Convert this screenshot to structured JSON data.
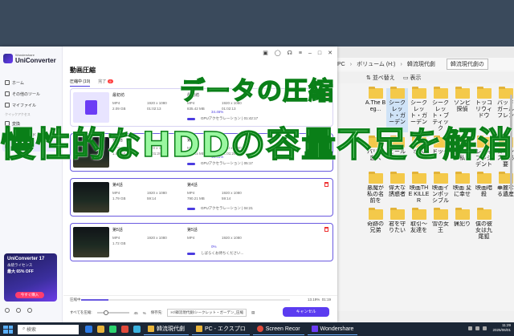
{
  "explorer": {
    "breadcrumb": [
      "PC",
      "ボリューム (H:)",
      "韓流現代劇"
    ],
    "current_folder": "韓流現代劇の",
    "commands": {
      "sort": "並べ替え",
      "view": "表示"
    },
    "folders": [
      "A.The Beg...",
      "シークレット・ガーデン",
      "シークレット・ガーデン",
      "シークレット・ブティック",
      "ゾンビ探偵",
      "トッコ リウィドウ",
      "バッド ガールフレン",
      "パリの恋人",
      "ビール",
      "ボス",
      "ドッグ",
      "ダンスは私と",
      "レディプレジデント",
      "ロマンスが必要",
      "悪魔が私の名前を",
      "偉大な誘惑者",
      "映画THE KILLER",
      "映画インポッシブル",
      "映画 変に幸せ",
      "映画暗殺",
      "華麗なる遺産",
      "奇跡の兄弟",
      "君を守りたい",
      "取引～友達を",
      "雪の女王",
      "猟犯り",
      "僕の彼女は九尾狐"
    ]
  },
  "app": {
    "brand_small": "Wondershare",
    "brand": "UniConverter",
    "page_title": "動画圧縮",
    "nav": [
      {
        "label": "ホーム",
        "active": false
      },
      {
        "label": "その他のツール",
        "active": false
      },
      {
        "label": "マイファイル",
        "active": false
      }
    ],
    "nav_group": "クイックアクセス",
    "nav2": [
      {
        "label": "変換",
        "active": false
      },
      {
        "label": "ダウンロード",
        "active": false
      },
      {
        "label": "動画圧縮",
        "active": true
      }
    ],
    "tabs": {
      "in_progress": "圧縮中 (19)",
      "done": "完了",
      "done_badge": "9"
    },
    "promo": {
      "title": "UniConverter 17",
      "line1": "永続ライセンス",
      "line2": "最大 65% OFF",
      "button": "今すぐ購入"
    },
    "tasks": [
      {
        "src_name": "最初坊",
        "dst_name": "最初坊",
        "fmt": "MP4",
        "res": "1920 x 1080",
        "size_src": "2.09 GB",
        "time": "01:02:13",
        "size_dst": "835.42 MB",
        "pct": "34.46%",
        "gpu": "GPUアクセラレーション | 01:42:17"
      },
      {
        "src_name": "第3話",
        "dst_name": "第3話",
        "fmt": "MP4",
        "res": "1920 x 1080",
        "size_src": "1.85 GB",
        "time": "01:01:29",
        "size_dst": "829.35 MB",
        "pct": "15.46%",
        "gpu": "GPUアクセラレーション | 05:17"
      },
      {
        "src_name": "第4話",
        "dst_name": "第4話",
        "fmt": "MP4",
        "res": "1920 x 1080",
        "size_src": "1.79 GB",
        "time": "59:14",
        "size_dst": "790.21 MB",
        "pct": "",
        "gpu": "GPUアクセラレーション | 04:21"
      },
      {
        "src_name": "第5話",
        "dst_name": "第5話",
        "fmt": "MP4",
        "res": "1920 x 1080",
        "size_src": "1.72 GB",
        "time": "",
        "size_dst": "",
        "pct": "0%",
        "gpu": "しばらくお待ちください..."
      }
    ],
    "footer": {
      "overall_label": "圧縮中",
      "overall_pct": "13.19%",
      "overall_time": "01:19",
      "overall_fraction": 0.13,
      "all_compress_label": "すべてを圧縮:",
      "quality_pct": "45",
      "quality_unit": "%",
      "output_label": "保存先:",
      "output_path": "H:\\韓流現代劇\\シークレット・ガーデン_圧縮",
      "cancel": "キャンセル"
    }
  },
  "overlay": {
    "headline1": "データの圧縮",
    "headline2": "慢性的なHDDの容量不足を解消"
  },
  "taskbar": {
    "search": "検索",
    "items": [
      "韓流現代劇",
      "PC - エクスプロ",
      "Screen Recor",
      "Wondershare"
    ],
    "time": "11:29",
    "date": "2025/06/01"
  }
}
